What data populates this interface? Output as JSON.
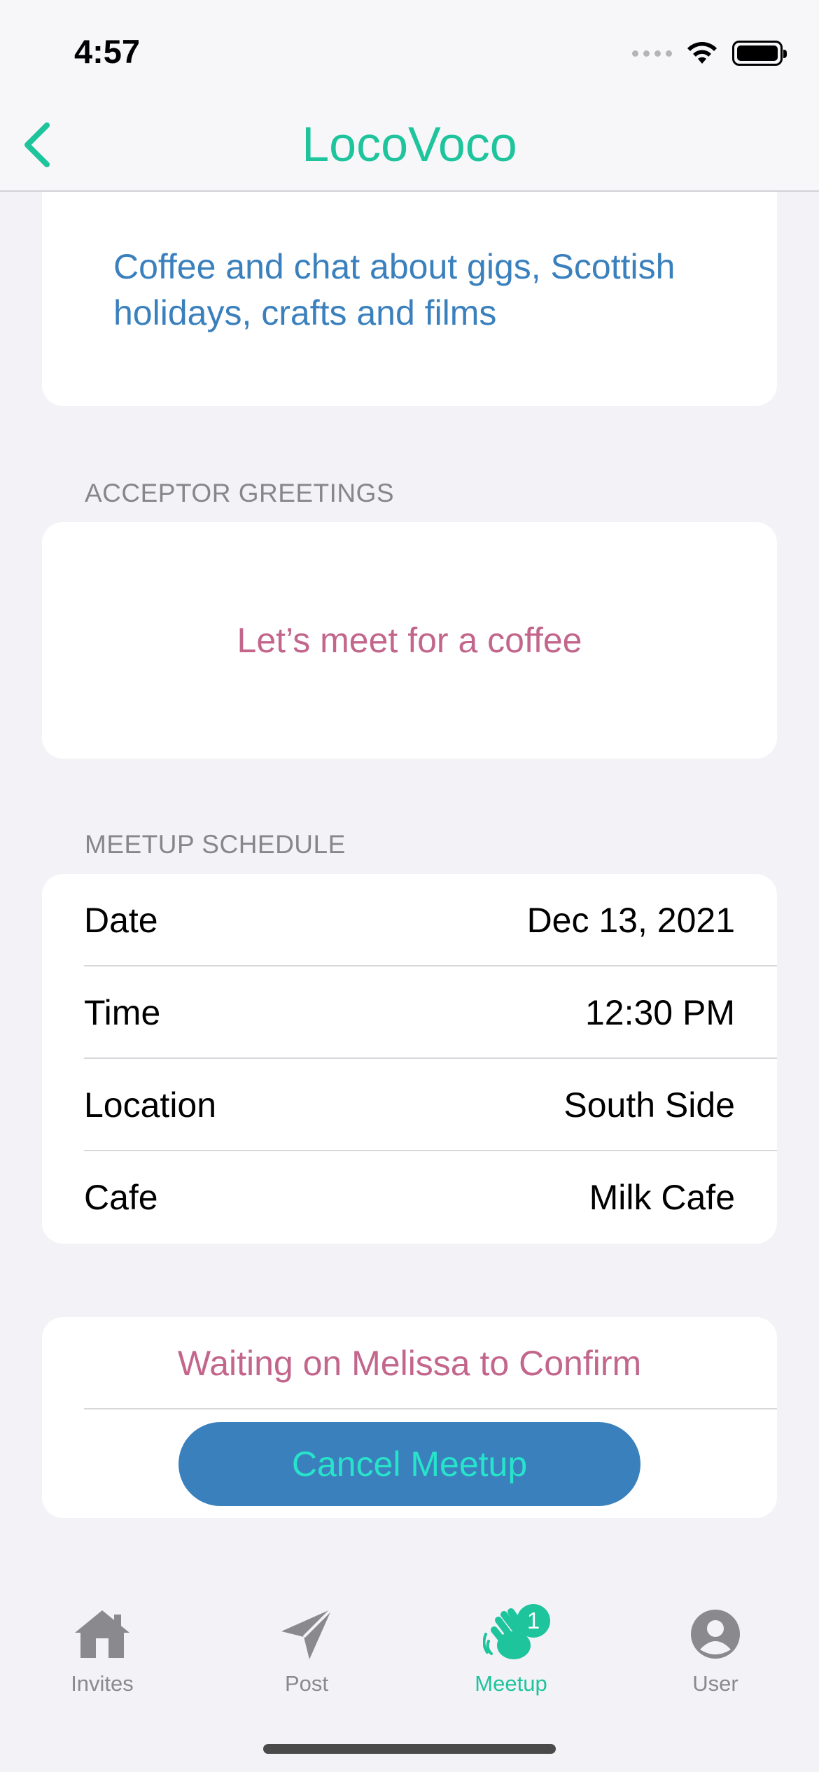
{
  "status_bar": {
    "time": "4:57"
  },
  "nav": {
    "title": "LocoVoco",
    "back_icon": "chevron-left-icon"
  },
  "description": {
    "text": "Coffee and chat about gigs, Scottish holidays, crafts and films"
  },
  "greetings": {
    "header": "ACCEPTOR GREETINGS",
    "text": "Let’s meet for a coffee"
  },
  "schedule": {
    "header": "MEETUP SCHEDULE",
    "rows": [
      {
        "label": "Date",
        "value": "Dec 13, 2021"
      },
      {
        "label": "Time",
        "value": "12:30 PM"
      },
      {
        "label": "Location",
        "value": "South Side"
      },
      {
        "label": "Cafe",
        "value": "Milk Cafe"
      }
    ]
  },
  "status": {
    "waiting_text": "Waiting on Melissa to Confirm",
    "cancel_label": "Cancel Meetup"
  },
  "tabs": [
    {
      "label": "Invites",
      "icon": "house-icon"
    },
    {
      "label": "Post",
      "icon": "paper-plane-icon"
    },
    {
      "label": "Meetup",
      "icon": "waving-hand-icon",
      "badge": "1",
      "active": true
    },
    {
      "label": "User",
      "icon": "person-circle-icon"
    }
  ],
  "colors": {
    "accent": "#1ec49c",
    "blue": "#3a80bd",
    "pink": "#c2668c",
    "cancel_text": "#27e3c9"
  }
}
